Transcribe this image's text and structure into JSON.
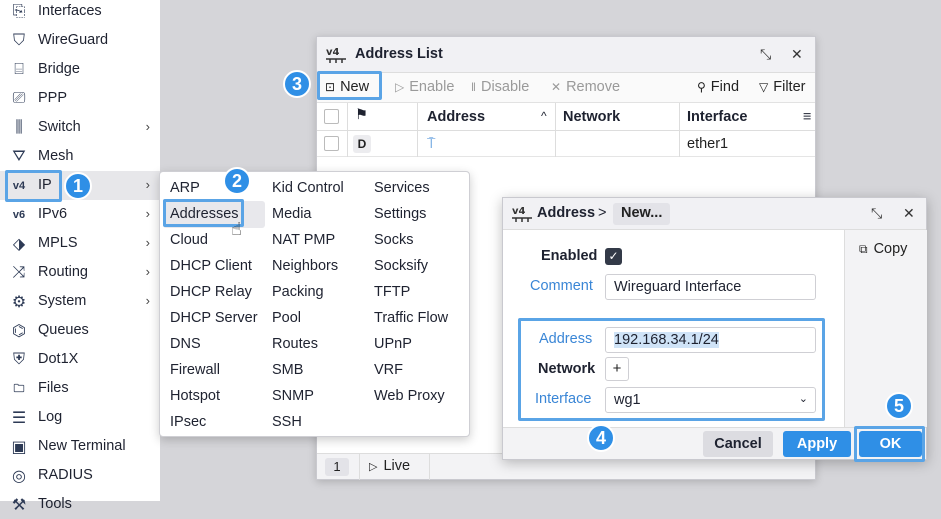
{
  "sidebar": {
    "items": [
      {
        "label": "Interfaces",
        "icon": "interfaces-icon",
        "chevron": ""
      },
      {
        "label": "WireGuard",
        "icon": "wireguard-icon",
        "chevron": ""
      },
      {
        "label": "Bridge",
        "icon": "bridge-icon",
        "chevron": ""
      },
      {
        "label": "PPP",
        "icon": "ppp-icon",
        "chevron": ""
      },
      {
        "label": "Switch",
        "icon": "switch-icon",
        "chevron": "›"
      },
      {
        "label": "Mesh",
        "icon": "mesh-icon",
        "chevron": ""
      },
      {
        "label": "IP",
        "icon": "ipv4-icon",
        "chevron": "›"
      },
      {
        "label": "IPv6",
        "icon": "ipv6-icon",
        "chevron": "›"
      },
      {
        "label": "MPLS",
        "icon": "mpls-icon",
        "chevron": "›"
      },
      {
        "label": "Routing",
        "icon": "routing-icon",
        "chevron": "›"
      },
      {
        "label": "System",
        "icon": "gear-icon",
        "chevron": "›"
      },
      {
        "label": "Queues",
        "icon": "queues-icon",
        "chevron": ""
      },
      {
        "label": "Dot1X",
        "icon": "dot1x-icon",
        "chevron": ""
      },
      {
        "label": "Files",
        "icon": "folder-icon",
        "chevron": ""
      },
      {
        "label": "Log",
        "icon": "log-icon",
        "chevron": ""
      },
      {
        "label": "New Terminal",
        "icon": "terminal-icon",
        "chevron": ""
      },
      {
        "label": "RADIUS",
        "icon": "radius-icon",
        "chevron": ""
      },
      {
        "label": "Tools",
        "icon": "tools-icon",
        "chevron": ""
      }
    ]
  },
  "badges": [
    "1",
    "2",
    "3",
    "4",
    "5"
  ],
  "address_list": {
    "title_icon": "v4",
    "title": "Address List",
    "toolbar": {
      "new": "New",
      "enable": "Enable",
      "disable": "Disable",
      "remove": "Remove",
      "find": "Find",
      "filter": "Filter"
    },
    "columns": [
      "Address",
      "Network",
      "Interface"
    ],
    "row": {
      "flag": "D",
      "interface": "ether1"
    },
    "status": {
      "page": "1",
      "live": "Live"
    }
  },
  "ip_menu": {
    "col1": [
      "ARP",
      "Addresses",
      "Cloud",
      "DHCP Client",
      "DHCP Relay",
      "DHCP Server",
      "DNS",
      "Firewall",
      "Hotspot",
      "IPsec"
    ],
    "col2": [
      "Kid Control",
      "Media",
      "NAT PMP",
      "Neighbors",
      "Packing",
      "Pool",
      "Routes",
      "SMB",
      "SNMP",
      "SSH"
    ],
    "col3": [
      "Services",
      "Settings",
      "Socks",
      "Socksify",
      "TFTP",
      "Traffic Flow",
      "UPnP",
      "VRF",
      "Web Proxy"
    ]
  },
  "dialog": {
    "title_icon": "v4",
    "crumb_root": "Address",
    "crumb_sep": ">",
    "crumb_current": "New...",
    "copy": "Copy",
    "enabled_label": "Enabled",
    "comment_label": "Comment",
    "comment_value": "Wireguard Interface",
    "address_label": "Address",
    "address_value": "192.168.34.1/24",
    "network_label": "Network",
    "network_add": "+",
    "interface_label": "Interface",
    "interface_value": "wg1",
    "cancel": "Cancel",
    "apply": "Apply",
    "ok": "OK"
  },
  "colors": {
    "accent": "#2f8fe6",
    "highlight": "#5aa4e6"
  }
}
